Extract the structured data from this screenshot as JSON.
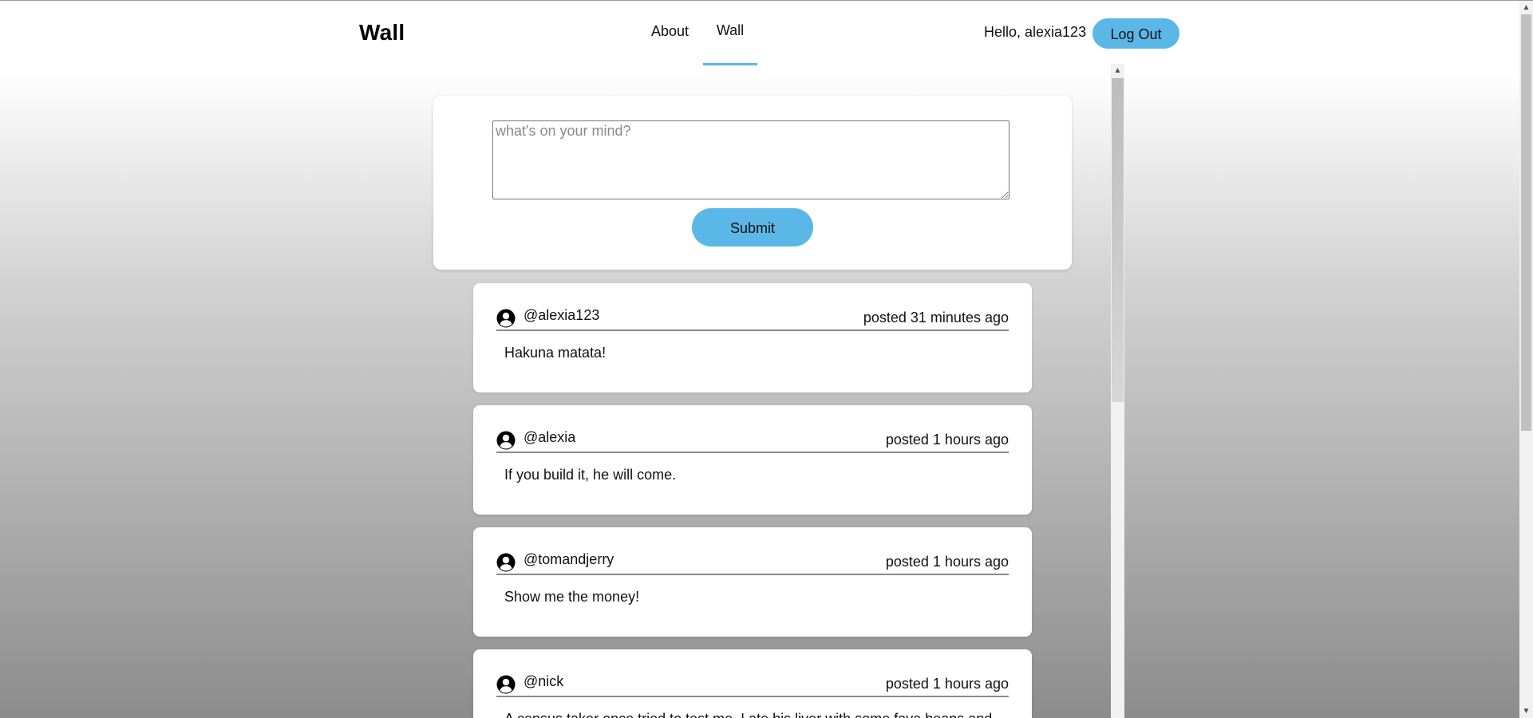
{
  "header": {
    "brand": "Wall",
    "nav": [
      {
        "label": "About"
      },
      {
        "label": "Wall"
      }
    ],
    "greeting": "Hello, alexia123",
    "logout_label": "Log Out"
  },
  "composer": {
    "placeholder": "what's on your mind?",
    "value": "",
    "submit_label": "Submit"
  },
  "posts": [
    {
      "user": "@alexia123",
      "time": "posted 31 minutes ago",
      "body": "Hakuna matata!"
    },
    {
      "user": "@alexia",
      "time": "posted 1 hours ago",
      "body": "If you build it, he will come."
    },
    {
      "user": "@tomandjerry",
      "time": "posted 1 hours ago",
      "body": "Show me the money!"
    },
    {
      "user": "@nick",
      "time": "posted 1 hours ago",
      "body": "A census taker once tried to test me. I ate his liver with some fava beans and"
    }
  ],
  "colors": {
    "accent": "#5bb7e8"
  },
  "icons": {
    "avatar": "user-circle-icon",
    "scroll_up": "chevron-up-icon",
    "scroll_down": "chevron-down-icon"
  }
}
